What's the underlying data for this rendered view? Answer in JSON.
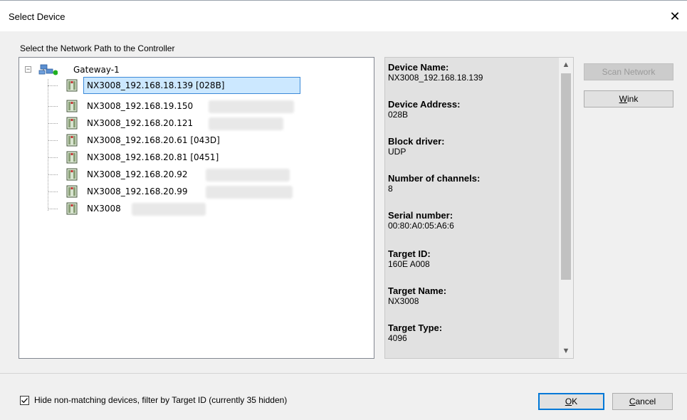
{
  "window": {
    "title": "Select Device",
    "close_glyph": "✕"
  },
  "group_label": "Select the Network Path to the Controller",
  "tree": {
    "root_label": "Gateway-1",
    "expander": "−",
    "nodes": [
      {
        "label": "NX3008_192.168.18.139 [028B]",
        "selected": true
      },
      {
        "label": "NX3008_192.168.19.150",
        "selected": false
      },
      {
        "label": "NX3008_192.168.20.121",
        "selected": false
      },
      {
        "label": "NX3008_192.168.20.61 [043D]",
        "selected": false
      },
      {
        "label": "NX3008_192.168.20.81 [0451]",
        "selected": false
      },
      {
        "label": "NX3008_192.168.20.92",
        "selected": false
      },
      {
        "label": "NX3008_192.168.20.99",
        "selected": false
      },
      {
        "label": "NX3008",
        "selected": false
      }
    ]
  },
  "details": {
    "props": [
      {
        "name": "Device Name:",
        "value": "NX3008_192.168.18.139"
      },
      {
        "name": "Device Address:",
        "value": "028B"
      },
      {
        "name": "Block driver:",
        "value": "UDP"
      },
      {
        "name": "Number of channels:",
        "value": "8"
      },
      {
        "name": "Serial number:",
        "value": "00:80:A0:05:A6:6"
      },
      {
        "name": "Target ID:",
        "value": "160E A008"
      },
      {
        "name": "Target Name:",
        "value": "NX3008"
      },
      {
        "name": "Target Type:",
        "value": "4096"
      }
    ],
    "scroll_up": "▲",
    "scroll_down": "▼"
  },
  "buttons": {
    "scan_network": "Scan Network",
    "wink_prefix": "",
    "wink_u": "W",
    "wink_rest": "ink",
    "ok_u": "O",
    "ok_rest": "K",
    "cancel_u": "C",
    "cancel_rest": "ancel"
  },
  "filter": {
    "checked": true,
    "check_glyph": "✓",
    "label": "Hide non-matching devices, filter by Target ID (currently 35 hidden)"
  },
  "colors": {
    "selection_bg": "#cce8ff",
    "selection_border": "#3c8ad8",
    "default_button_border": "#0078d7",
    "status_dot": "#20b020"
  }
}
